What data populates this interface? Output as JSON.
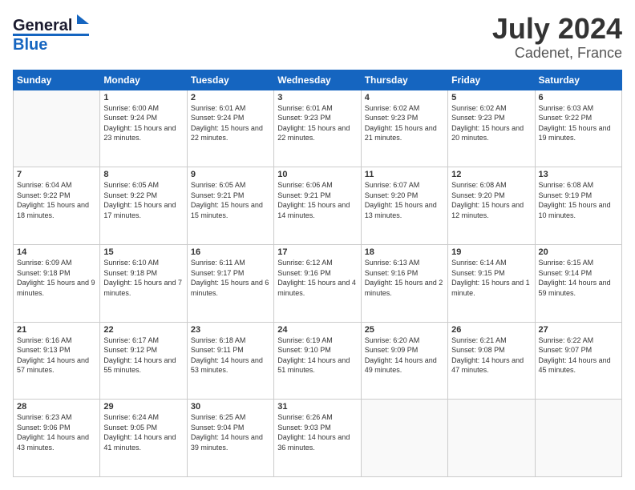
{
  "header": {
    "logo": {
      "line1": "General",
      "line2": "Blue"
    },
    "title": "July 2024",
    "subtitle": "Cadenet, France"
  },
  "calendar": {
    "days_of_week": [
      "Sunday",
      "Monday",
      "Tuesday",
      "Wednesday",
      "Thursday",
      "Friday",
      "Saturday"
    ],
    "weeks": [
      [
        {
          "day": "",
          "sunrise": "",
          "sunset": "",
          "daylight": ""
        },
        {
          "day": "1",
          "sunrise": "Sunrise: 6:00 AM",
          "sunset": "Sunset: 9:24 PM",
          "daylight": "Daylight: 15 hours and 23 minutes."
        },
        {
          "day": "2",
          "sunrise": "Sunrise: 6:01 AM",
          "sunset": "Sunset: 9:24 PM",
          "daylight": "Daylight: 15 hours and 22 minutes."
        },
        {
          "day": "3",
          "sunrise": "Sunrise: 6:01 AM",
          "sunset": "Sunset: 9:23 PM",
          "daylight": "Daylight: 15 hours and 22 minutes."
        },
        {
          "day": "4",
          "sunrise": "Sunrise: 6:02 AM",
          "sunset": "Sunset: 9:23 PM",
          "daylight": "Daylight: 15 hours and 21 minutes."
        },
        {
          "day": "5",
          "sunrise": "Sunrise: 6:02 AM",
          "sunset": "Sunset: 9:23 PM",
          "daylight": "Daylight: 15 hours and 20 minutes."
        },
        {
          "day": "6",
          "sunrise": "Sunrise: 6:03 AM",
          "sunset": "Sunset: 9:22 PM",
          "daylight": "Daylight: 15 hours and 19 minutes."
        }
      ],
      [
        {
          "day": "7",
          "sunrise": "Sunrise: 6:04 AM",
          "sunset": "Sunset: 9:22 PM",
          "daylight": "Daylight: 15 hours and 18 minutes."
        },
        {
          "day": "8",
          "sunrise": "Sunrise: 6:05 AM",
          "sunset": "Sunset: 9:22 PM",
          "daylight": "Daylight: 15 hours and 17 minutes."
        },
        {
          "day": "9",
          "sunrise": "Sunrise: 6:05 AM",
          "sunset": "Sunset: 9:21 PM",
          "daylight": "Daylight: 15 hours and 15 minutes."
        },
        {
          "day": "10",
          "sunrise": "Sunrise: 6:06 AM",
          "sunset": "Sunset: 9:21 PM",
          "daylight": "Daylight: 15 hours and 14 minutes."
        },
        {
          "day": "11",
          "sunrise": "Sunrise: 6:07 AM",
          "sunset": "Sunset: 9:20 PM",
          "daylight": "Daylight: 15 hours and 13 minutes."
        },
        {
          "day": "12",
          "sunrise": "Sunrise: 6:08 AM",
          "sunset": "Sunset: 9:20 PM",
          "daylight": "Daylight: 15 hours and 12 minutes."
        },
        {
          "day": "13",
          "sunrise": "Sunrise: 6:08 AM",
          "sunset": "Sunset: 9:19 PM",
          "daylight": "Daylight: 15 hours and 10 minutes."
        }
      ],
      [
        {
          "day": "14",
          "sunrise": "Sunrise: 6:09 AM",
          "sunset": "Sunset: 9:18 PM",
          "daylight": "Daylight: 15 hours and 9 minutes."
        },
        {
          "day": "15",
          "sunrise": "Sunrise: 6:10 AM",
          "sunset": "Sunset: 9:18 PM",
          "daylight": "Daylight: 15 hours and 7 minutes."
        },
        {
          "day": "16",
          "sunrise": "Sunrise: 6:11 AM",
          "sunset": "Sunset: 9:17 PM",
          "daylight": "Daylight: 15 hours and 6 minutes."
        },
        {
          "day": "17",
          "sunrise": "Sunrise: 6:12 AM",
          "sunset": "Sunset: 9:16 PM",
          "daylight": "Daylight: 15 hours and 4 minutes."
        },
        {
          "day": "18",
          "sunrise": "Sunrise: 6:13 AM",
          "sunset": "Sunset: 9:16 PM",
          "daylight": "Daylight: 15 hours and 2 minutes."
        },
        {
          "day": "19",
          "sunrise": "Sunrise: 6:14 AM",
          "sunset": "Sunset: 9:15 PM",
          "daylight": "Daylight: 15 hours and 1 minute."
        },
        {
          "day": "20",
          "sunrise": "Sunrise: 6:15 AM",
          "sunset": "Sunset: 9:14 PM",
          "daylight": "Daylight: 14 hours and 59 minutes."
        }
      ],
      [
        {
          "day": "21",
          "sunrise": "Sunrise: 6:16 AM",
          "sunset": "Sunset: 9:13 PM",
          "daylight": "Daylight: 14 hours and 57 minutes."
        },
        {
          "day": "22",
          "sunrise": "Sunrise: 6:17 AM",
          "sunset": "Sunset: 9:12 PM",
          "daylight": "Daylight: 14 hours and 55 minutes."
        },
        {
          "day": "23",
          "sunrise": "Sunrise: 6:18 AM",
          "sunset": "Sunset: 9:11 PM",
          "daylight": "Daylight: 14 hours and 53 minutes."
        },
        {
          "day": "24",
          "sunrise": "Sunrise: 6:19 AM",
          "sunset": "Sunset: 9:10 PM",
          "daylight": "Daylight: 14 hours and 51 minutes."
        },
        {
          "day": "25",
          "sunrise": "Sunrise: 6:20 AM",
          "sunset": "Sunset: 9:09 PM",
          "daylight": "Daylight: 14 hours and 49 minutes."
        },
        {
          "day": "26",
          "sunrise": "Sunrise: 6:21 AM",
          "sunset": "Sunset: 9:08 PM",
          "daylight": "Daylight: 14 hours and 47 minutes."
        },
        {
          "day": "27",
          "sunrise": "Sunrise: 6:22 AM",
          "sunset": "Sunset: 9:07 PM",
          "daylight": "Daylight: 14 hours and 45 minutes."
        }
      ],
      [
        {
          "day": "28",
          "sunrise": "Sunrise: 6:23 AM",
          "sunset": "Sunset: 9:06 PM",
          "daylight": "Daylight: 14 hours and 43 minutes."
        },
        {
          "day": "29",
          "sunrise": "Sunrise: 6:24 AM",
          "sunset": "Sunset: 9:05 PM",
          "daylight": "Daylight: 14 hours and 41 minutes."
        },
        {
          "day": "30",
          "sunrise": "Sunrise: 6:25 AM",
          "sunset": "Sunset: 9:04 PM",
          "daylight": "Daylight: 14 hours and 39 minutes."
        },
        {
          "day": "31",
          "sunrise": "Sunrise: 6:26 AM",
          "sunset": "Sunset: 9:03 PM",
          "daylight": "Daylight: 14 hours and 36 minutes."
        },
        {
          "day": "",
          "sunrise": "",
          "sunset": "",
          "daylight": ""
        },
        {
          "day": "",
          "sunrise": "",
          "sunset": "",
          "daylight": ""
        },
        {
          "day": "",
          "sunrise": "",
          "sunset": "",
          "daylight": ""
        }
      ]
    ]
  }
}
